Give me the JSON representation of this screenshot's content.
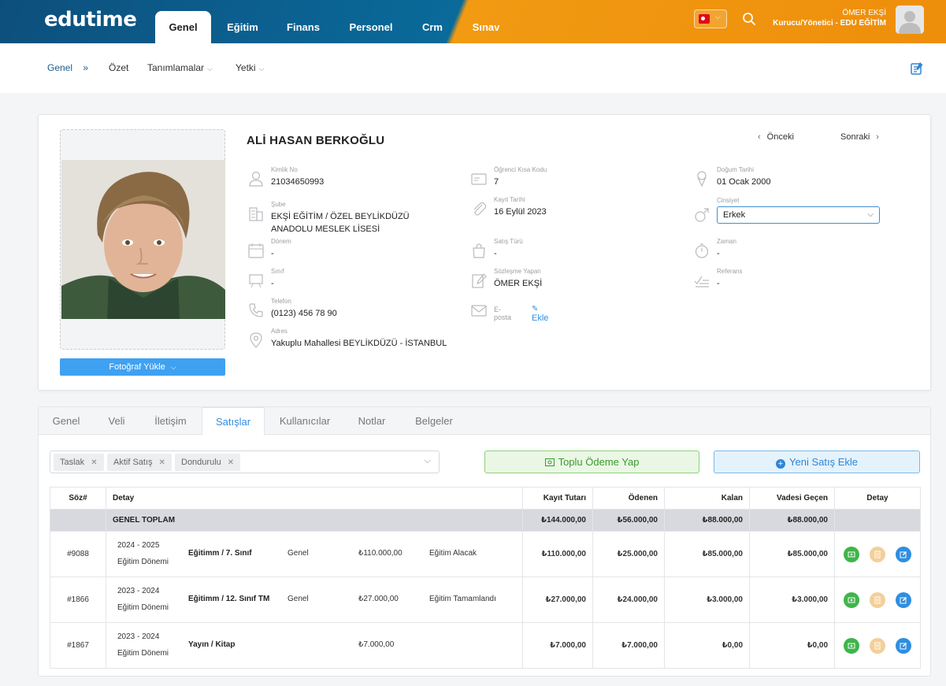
{
  "app": {
    "logo": "edutime"
  },
  "topnav": {
    "tabs": [
      {
        "label": "Genel",
        "active": true
      },
      {
        "label": "Eğitim"
      },
      {
        "label": "Finans"
      },
      {
        "label": "Personel"
      },
      {
        "label": "Crm"
      },
      {
        "label": "Sınav"
      }
    ],
    "user": {
      "name": "ÖMER EKŞİ",
      "role": "Kurucu/Yönetici - EDU EĞİTİM"
    }
  },
  "subnav": {
    "items": [
      {
        "label": "Genel",
        "active": true
      },
      {
        "label": "Özet"
      },
      {
        "label": "Tanımlamalar"
      },
      {
        "label": "Yetki"
      }
    ]
  },
  "profile": {
    "name": "ALİ HASAN BERKOĞLU",
    "prev": "Önceki",
    "next": "Sonraki",
    "upload_label": "Fotoğraf Yükle",
    "fields": {
      "kimlik": {
        "label": "Kimlik No",
        "value": "21034650993"
      },
      "sube": {
        "label": "Şube",
        "value1": "EKŞİ EĞİTİM / ÖZEL BEYLİKDÜZÜ",
        "value2": "ANADOLU MESLEK LİSESİ"
      },
      "donem": {
        "label": "Dönem",
        "value": "-"
      },
      "sinif": {
        "label": "Sınıf",
        "value": "-"
      },
      "telefon": {
        "label": "Telefon",
        "value": "(0123) 456 78 90"
      },
      "adres": {
        "label": "Adres",
        "value": "Yakuplu Mahallesi BEYLİKDÜZÜ - İSTANBUL"
      },
      "kisa_kod": {
        "label": "Öğrenci Kısa Kodu",
        "value": "7"
      },
      "kayit_tarihi": {
        "label": "Kayıt Tarihi",
        "value": "16 Eylül 2023"
      },
      "satis_turu": {
        "label": "Satış Türü",
        "value": "-"
      },
      "sozlesme": {
        "label": "Sözleşme Yapan",
        "value": "ÖMER EKŞİ"
      },
      "eposta": {
        "label": "E-posta",
        "action": "Ekle"
      },
      "dogum": {
        "label": "Doğum Tarihi",
        "value": "01 Ocak 2000"
      },
      "cinsiyet": {
        "label": "Cinsiyet",
        "value": "Erkek"
      },
      "zaman": {
        "label": "Zaman",
        "value": "-"
      },
      "referans": {
        "label": "Referans",
        "value": "-"
      }
    }
  },
  "tabs": [
    {
      "label": "Genel"
    },
    {
      "label": "Veli"
    },
    {
      "label": "İletişim"
    },
    {
      "label": "Satışlar",
      "active": true
    },
    {
      "label": "Kullanıcılar"
    },
    {
      "label": "Notlar"
    },
    {
      "label": "Belgeler"
    }
  ],
  "filter": {
    "chips": [
      "Taslak",
      "Aktif Satış",
      "Dondurulu"
    ]
  },
  "buttons": {
    "pay": "Toplu Ödeme Yap",
    "new_sale": "Yeni Satış Ekle"
  },
  "table": {
    "headers": [
      "Söz#",
      "Detay",
      "Kayıt Tutarı",
      "Ödenen",
      "Kalan",
      "Vadesi Geçen",
      "Detay"
    ],
    "total": {
      "label": "GENEL TOPLAM",
      "kayit": "₺144.000,00",
      "odenen": "₺56.000,00",
      "kalan": "₺88.000,00",
      "vadesi": "₺88.000,00"
    },
    "rows": [
      {
        "no": "#9088",
        "years": "2024 - 2025",
        "period": "Eğitim Dönemi",
        "product": "Eğitimm / 7. Sınıf",
        "type": "Genel",
        "price": "₺110.000,00",
        "status": "Eğitim Alacak",
        "kayit": "₺110.000,00",
        "odenen": "₺25.000,00",
        "kalan": "₺85.000,00",
        "vadesi": "₺85.000,00"
      },
      {
        "no": "#1866",
        "years": "2023 - 2024",
        "period": "Eğitim Dönemi",
        "product": "Eğitimm / 12. Sınıf TM",
        "type": "Genel",
        "price": "₺27.000,00",
        "status": "Eğitim Tamamlandı",
        "kayit": "₺27.000,00",
        "odenen": "₺24.000,00",
        "kalan": "₺3.000,00",
        "vadesi": "₺3.000,00"
      },
      {
        "no": "#1867",
        "years": "2023 - 2024",
        "period": "Eğitim Dönemi",
        "product": "Yayın / Kitap",
        "type": "",
        "price": "₺7.000,00",
        "status": "",
        "kayit": "₺7.000,00",
        "odenen": "₺7.000,00",
        "kalan": "₺0,00",
        "vadesi": "₺0,00"
      }
    ]
  }
}
